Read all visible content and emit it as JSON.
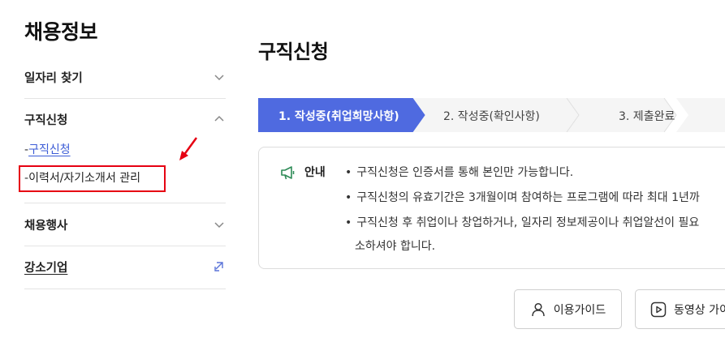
{
  "sidebar": {
    "title": "채용정보",
    "menu": [
      {
        "label": "일자리 찾기"
      },
      {
        "label": "구직신청"
      },
      {
        "label": "채용행사"
      },
      {
        "label": "강소기업"
      }
    ],
    "submenu": [
      {
        "dash": "-",
        "label": "구직신청"
      },
      {
        "dash": "-",
        "label": "이력서/자기소개서 관리"
      }
    ]
  },
  "main": {
    "title": "구직신청",
    "steps": [
      {
        "label": "1. 작성중(취업희망사항)",
        "active": true
      },
      {
        "label": "2. 작성중(확인사항)",
        "active": false
      },
      {
        "label": "3. 제출완료",
        "active": false
      }
    ],
    "notice": {
      "label": "안내",
      "bullet": "•",
      "items": [
        "구직신청은 인증서를 통해 본인만 가능합니다.",
        "구직신청의 유효기간은 3개월이며 참여하는 프로그램에 따라 최대 1년까",
        "구직신청 후 취업이나 창업하거나, 일자리 정보제공이나 취업알선이 필요",
        "소하셔야 합니다."
      ]
    },
    "buttons": {
      "guide": "이용가이드",
      "video": "동영상 가이"
    }
  },
  "colors": {
    "accent": "#4f6ae0",
    "link": "#3b5bd6",
    "highlight": "#e60012"
  }
}
